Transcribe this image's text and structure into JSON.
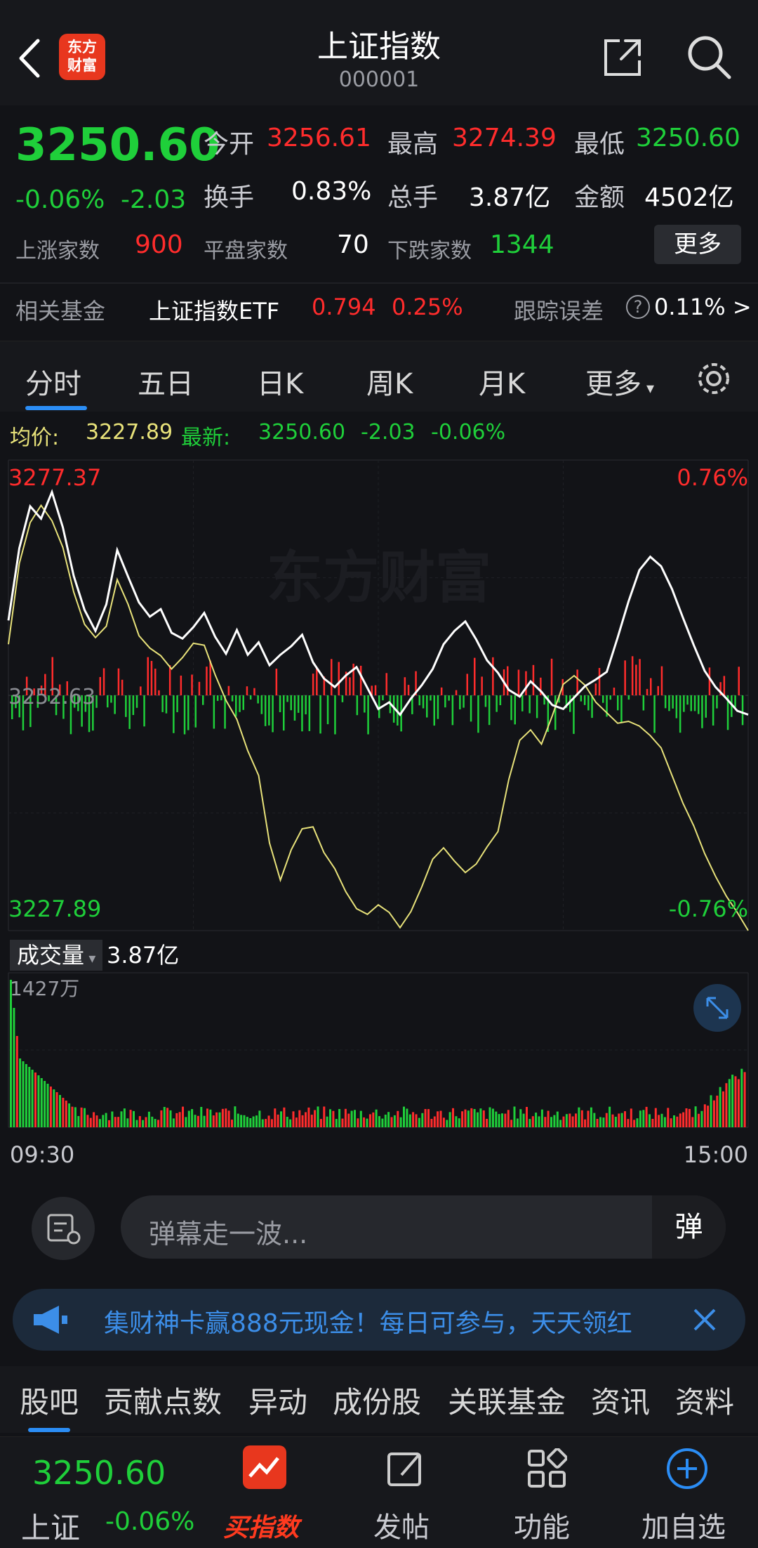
{
  "header": {
    "title": "上证指数",
    "code": "000001",
    "logo_text_1": "东方",
    "logo_text_2": "财富"
  },
  "quote": {
    "price": "3250.60",
    "change_pct": "-0.06%",
    "change": "-2.03",
    "open_label": "今开",
    "open": "3256.61",
    "high_label": "最高",
    "high": "3274.39",
    "low_label": "最低",
    "low": "3250.60",
    "turnover_label": "换手",
    "turnover": "0.83%",
    "volume_label": "总手",
    "volume": "3.87亿",
    "amount_label": "金额",
    "amount": "4502亿",
    "up_label": "上涨家数",
    "up": "900",
    "flat_label": "平盘家数",
    "flat": "70",
    "down_label": "下跌家数",
    "down": "1344",
    "more_button": "更多"
  },
  "fund": {
    "label": "相关基金",
    "name": "上证指数ETF",
    "price": "0.794",
    "pct": "0.25%",
    "tracking_label": "跟踪误差",
    "tracking_value": "0.11% >"
  },
  "tabs": [
    "分时",
    "五日",
    "日K",
    "周K",
    "月K",
    "更多"
  ],
  "avg": {
    "label": "均价:",
    "value": "3227.89",
    "latest_label": "最新:",
    "latest": "3250.60",
    "change": "-2.03",
    "pct": "-0.06%"
  },
  "chart_axis": {
    "top_price": "3277.37",
    "top_pct": "0.76%",
    "mid_price": "3252.63",
    "bottom_price": "3227.89",
    "bottom_pct": "-0.76%",
    "watermark": "东方财富"
  },
  "volume": {
    "label": "成交量",
    "total": "3.87亿",
    "max": "1427万",
    "time_start": "09:30",
    "time_end": "15:00"
  },
  "danmu": {
    "placeholder": "弹幕走一波...",
    "button": "弹"
  },
  "banner": {
    "text": "集财神卡赢888元现金！每日可参与，天天领红"
  },
  "subtabs": [
    "股吧",
    "贡献点数",
    "异动",
    "成份股",
    "关联基金",
    "资讯",
    "资料"
  ],
  "bottom": {
    "price": "3250.60",
    "name": "上证",
    "pct": "-0.06%",
    "buy": "买指数",
    "post": "发帖",
    "func": "功能",
    "add": "加自选"
  },
  "colors": {
    "up": "#ff2c2c",
    "down": "#1fcf3a",
    "accent": "#2b8df5",
    "price_line": "#ffffff",
    "avg_line": "#e8e27a"
  },
  "chart_data": {
    "type": "line",
    "ylim": [
      3227.89,
      3277.37
    ],
    "prev_close": 3252.63,
    "series": [
      {
        "values": [
          3260.5,
          3268.1,
          3272.5,
          3271.2,
          3274.0,
          3270.3,
          3265.2,
          3261.6,
          3259.4,
          3262.2,
          3267.9,
          3265.1,
          3262.4,
          3260.9,
          3261.7,
          3259.2,
          3258.6,
          3259.8,
          3261.3,
          3258.8,
          3257.0,
          3259.5,
          3256.9,
          3258.2,
          3255.8,
          3256.9,
          3257.8,
          3259.0,
          3256.1,
          3254.4,
          3253.5,
          3254.7,
          3255.6,
          3253.4,
          3251.2,
          3251.9,
          3250.6,
          3252.3,
          3253.7,
          3255.4,
          3258.0,
          3259.4,
          3260.4,
          3258.5,
          3256.3,
          3255.0,
          3253.2,
          3252.5,
          3254.1,
          3253.0,
          3251.6,
          3251.2,
          3252.4,
          3253.6,
          3254.3,
          3255.1,
          3258.7,
          3262.5,
          3265.8,
          3267.2,
          3266.2,
          3263.8,
          3260.8,
          3257.9,
          3255.2,
          3253.5,
          3252.3,
          3251.0,
          3250.6
        ]
      },
      {
        "values": [
          3258.0,
          3266.5,
          3270.8,
          3272.6,
          3271.0,
          3268.2,
          3263.5,
          3260.1,
          3258.7,
          3259.9,
          3264.8,
          3262.2,
          3258.9,
          3257.6,
          3256.8,
          3255.4,
          3256.6,
          3258.1,
          3257.9,
          3254.8,
          3252.1,
          3250.1,
          3246.8,
          3244.2,
          3237.1,
          3233.2,
          3236.4,
          3238.6,
          3238.8,
          3236.1,
          3234.4,
          3232.0,
          3230.2,
          3229.6,
          3230.6,
          3229.8,
          3228.2,
          3229.9,
          3232.5,
          3235.4,
          3236.6,
          3235.2,
          3234.0,
          3234.9,
          3236.7,
          3238.3,
          3243.8,
          3247.9,
          3249.0,
          3247.5,
          3250.5,
          3253.8,
          3254.7,
          3253.7,
          3251.9,
          3250.8,
          3249.7,
          3249.9,
          3249.4,
          3248.4,
          3247.1,
          3244.2,
          3241.3,
          3238.9,
          3236.0,
          3233.6,
          3231.5,
          3229.8,
          3227.9
        ]
      }
    ]
  }
}
